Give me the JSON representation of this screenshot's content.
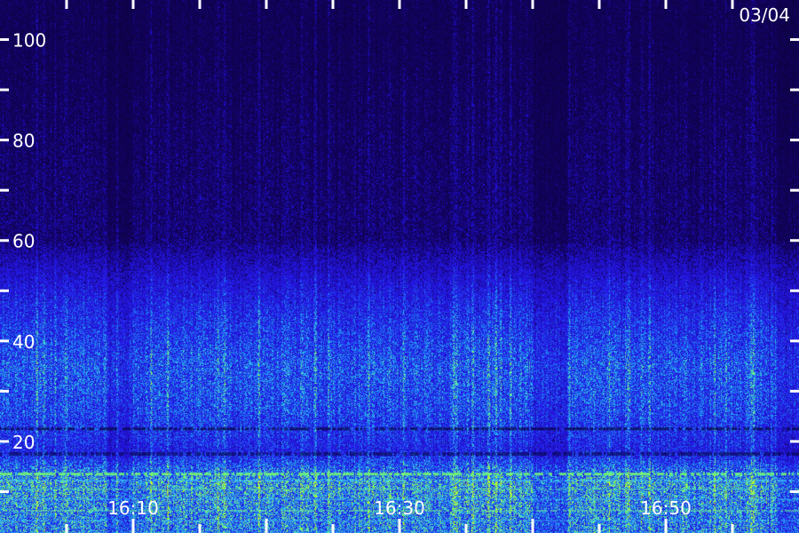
{
  "chart_data": {
    "type": "heatmap",
    "title": "",
    "date_label": "03/04",
    "xlabel": "",
    "ylabel": "",
    "x_range": [
      "16:00",
      "17:00"
    ],
    "x_tick_labels": [
      "16:10",
      "16:30",
      "16:50"
    ],
    "x_tick_values": [
      "16:10",
      "16:30",
      "16:50"
    ],
    "x_minor_tick_minutes": 5,
    "ylim": [
      0,
      110
    ],
    "y_tick_labels": [
      "20",
      "40",
      "60",
      "80",
      "100"
    ],
    "y_tick_values": [
      20,
      40,
      60,
      80,
      100
    ],
    "y_minor_tick_values": [
      10,
      30,
      50,
      70,
      90
    ],
    "intensity_profile": [
      {
        "y": 5,
        "level": 0.9,
        "color": "#40e0ff"
      },
      {
        "y": 12,
        "level": 1.0,
        "color": "#60ff80"
      },
      {
        "y": 18,
        "level": 0.55,
        "color": "#3a50ff"
      },
      {
        "y": 26,
        "level": 0.7,
        "color": "#2a8cff"
      },
      {
        "y": 35,
        "level": 0.75,
        "color": "#2f6bff"
      },
      {
        "y": 45,
        "level": 0.6,
        "color": "#2a44ff"
      },
      {
        "y": 52,
        "level": 0.45,
        "color": "#2533e0"
      },
      {
        "y": 60,
        "level": 0.2,
        "color": "#1a10a0"
      },
      {
        "y": 100,
        "level": 0.15,
        "color": "#180c80"
      }
    ],
    "colors": {
      "background": "#14064a",
      "low": "#1a0c7a",
      "mid": "#2a3cff",
      "high": "#3fd6ff",
      "peak": "#7cff70"
    },
    "grid": false,
    "legend": "none"
  }
}
